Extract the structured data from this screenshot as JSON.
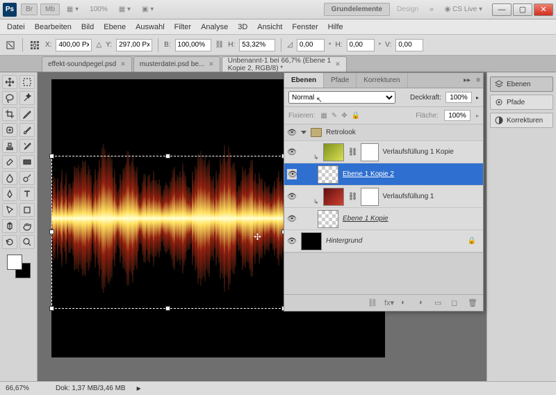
{
  "titlebar": {
    "zoom": "100%",
    "grundelemente": "Grundelemente",
    "design": "Design",
    "cslive": "CS Live"
  },
  "menu": [
    "Datei",
    "Bearbeiten",
    "Bild",
    "Ebene",
    "Auswahl",
    "Filter",
    "Analyse",
    "3D",
    "Ansicht",
    "Fenster",
    "Hilfe"
  ],
  "options": {
    "x_label": "X:",
    "x": "400,00 Px",
    "y_label": "Y:",
    "y": "297,00 Px",
    "w_label": "B:",
    "w": "100,00%",
    "h_label": "H:",
    "h": "53,32%",
    "angle_label": "",
    "angle": "0,00",
    "hskew_label": "H:",
    "hskew": "0,00",
    "vskew_label": "V:",
    "vskew": "0,00"
  },
  "doctabs": [
    {
      "label": "effekt-soundpegel.psd",
      "active": false
    },
    {
      "label": "musterdatei.psd be...",
      "active": false
    },
    {
      "label": "Unbenannt-1 bei 66,7% (Ebene 1 Kopie 2, RGB/8) *",
      "active": true
    }
  ],
  "rightbar": [
    {
      "label": "Ebenen",
      "active": true,
      "name": "ebenen"
    },
    {
      "label": "Pfade",
      "active": false,
      "name": "pfade"
    },
    {
      "label": "Korrekturen",
      "active": false,
      "name": "korrekturen"
    }
  ],
  "panel": {
    "tabs": [
      "Ebenen",
      "Pfade",
      "Korrekturen"
    ],
    "blend": "Normal",
    "deckkraft_label": "Deckkraft:",
    "deckkraft": "100%",
    "fixieren_label": "Fixieren:",
    "flaeche_label": "Fläche:",
    "flaeche": "100%",
    "group": "Retrolook",
    "layers": [
      {
        "name": "Verlaufsfüllung 1 Kopie",
        "thumb": "grad1",
        "mask": true,
        "sel": false,
        "linkunder": false
      },
      {
        "name": "Ebene 1 Kopie 2",
        "thumb": "checker",
        "mask": false,
        "sel": true,
        "linkunder": true
      },
      {
        "name": "Verlaufsfüllung 1",
        "thumb": "grad2",
        "mask": true,
        "sel": false,
        "linkunder": false
      },
      {
        "name": "Ebene 1 Kopie",
        "thumb": "checker",
        "mask": false,
        "sel": false,
        "linkunder": true,
        "italic": true
      }
    ],
    "background": "Hintergrund"
  },
  "status": {
    "zoom": "66,67%",
    "dok": "Dok: 1,37 MB/3,46 MB"
  }
}
